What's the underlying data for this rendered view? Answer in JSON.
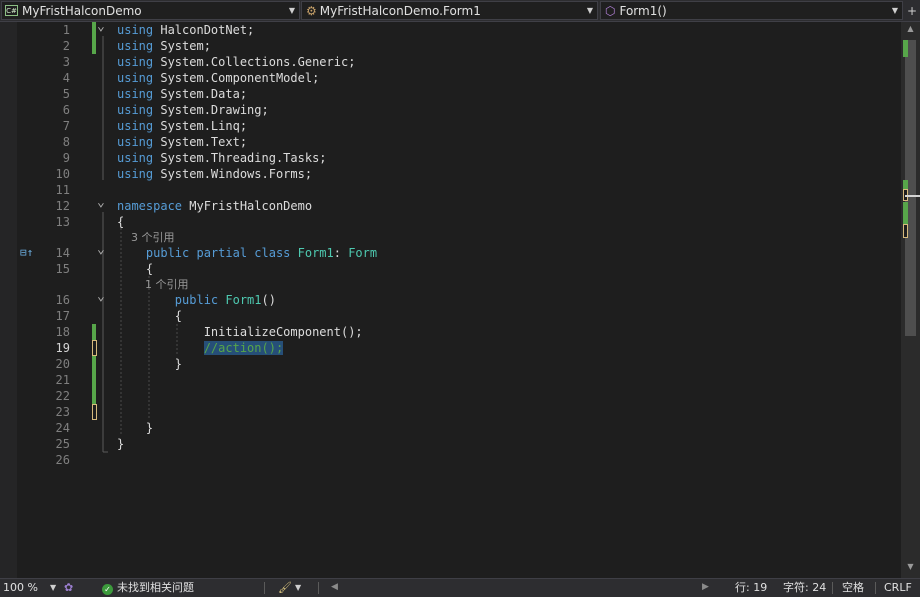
{
  "nav": {
    "project": "MyFristHalconDemo",
    "class": "MyFristHalconDemo.Form1",
    "member": "Form1()"
  },
  "lines": [
    {
      "n": "1",
      "fold": "v",
      "parts": [
        [
          "kw",
          "using"
        ],
        [
          "",
          "HalconDotNet;"
        ]
      ]
    },
    {
      "n": "2",
      "parts": [
        [
          "kw",
          "using"
        ],
        [
          "",
          "System;"
        ]
      ]
    },
    {
      "n": "3",
      "parts": [
        [
          "kw",
          "using"
        ],
        [
          "",
          "System.Collections.Generic;"
        ]
      ]
    },
    {
      "n": "4",
      "parts": [
        [
          "kw",
          "using"
        ],
        [
          "",
          "System.ComponentModel;"
        ]
      ]
    },
    {
      "n": "5",
      "parts": [
        [
          "kw",
          "using"
        ],
        [
          "",
          "System.Data;"
        ]
      ]
    },
    {
      "n": "6",
      "parts": [
        [
          "kw",
          "using"
        ],
        [
          "",
          "System.Drawing;"
        ]
      ]
    },
    {
      "n": "7",
      "parts": [
        [
          "kw",
          "using"
        ],
        [
          "",
          "System.Linq;"
        ]
      ]
    },
    {
      "n": "8",
      "parts": [
        [
          "kw",
          "using"
        ],
        [
          "",
          "System.Text;"
        ]
      ]
    },
    {
      "n": "9",
      "parts": [
        [
          "kw",
          "using"
        ],
        [
          "",
          "System.Threading.Tasks;"
        ]
      ]
    },
    {
      "n": "10",
      "parts": [
        [
          "kw",
          "using"
        ],
        [
          "ns",
          "System.Windows.Forms;"
        ]
      ]
    },
    {
      "n": "11",
      "parts": []
    },
    {
      "n": "12",
      "fold": "v",
      "parts": [
        [
          "kw",
          "namespace"
        ],
        [
          "ns",
          "MyFristHalconDemo"
        ]
      ]
    },
    {
      "n": "13",
      "parts": [
        [
          "",
          "{"
        ]
      ]
    },
    {
      "ref": "3 个引用",
      "indent": "    "
    },
    {
      "n": "14",
      "fold": "v",
      "parts": [
        [
          "",
          "    "
        ],
        [
          "kw",
          "public partial class"
        ],
        [
          "ty",
          "Form1"
        ],
        [
          "",
          ": "
        ],
        [
          "ty",
          "Form"
        ]
      ]
    },
    {
      "n": "15",
      "parts": [
        [
          "",
          "    {"
        ]
      ]
    },
    {
      "ref": "1 个引用",
      "indent": "        "
    },
    {
      "n": "16",
      "fold": "v",
      "parts": [
        [
          "",
          "        "
        ],
        [
          "kw",
          "public"
        ],
        [
          "ty",
          "Form1"
        ],
        [
          "",
          "()"
        ]
      ]
    },
    {
      "n": "17",
      "parts": [
        [
          "",
          "        {"
        ]
      ]
    },
    {
      "n": "18",
      "parts": [
        [
          "",
          "            InitializeComponent();"
        ]
      ]
    },
    {
      "n": "19",
      "parts": [
        [
          "",
          "            "
        ],
        [
          "cm sel",
          "//action();"
        ]
      ]
    },
    {
      "n": "20",
      "parts": [
        [
          "",
          "        }"
        ]
      ]
    },
    {
      "n": "21",
      "parts": []
    },
    {
      "n": "22",
      "parts": []
    },
    {
      "n": "23",
      "parts": []
    },
    {
      "n": "24",
      "parts": [
        [
          "",
          "    }"
        ]
      ]
    },
    {
      "n": "25",
      "parts": [
        [
          "",
          "}"
        ]
      ]
    },
    {
      "n": "26",
      "parts": []
    }
  ],
  "status": {
    "zoom": "100 %",
    "issues": "未找到相关问题",
    "line": "行: 19",
    "col": "字符: 24",
    "space": "空格",
    "eol": "CRLF"
  }
}
